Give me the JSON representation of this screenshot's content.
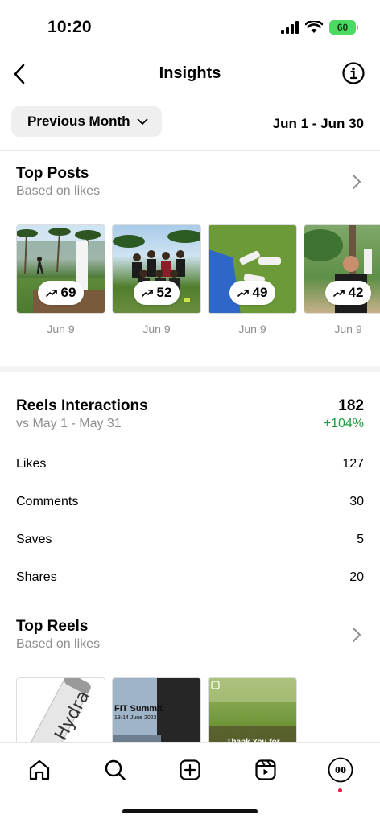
{
  "status_bar": {
    "time": "10:20",
    "battery": "60"
  },
  "header": {
    "title": "Insights"
  },
  "filter": {
    "period": "Previous Month",
    "date_range": "Jun 1 - Jun 30"
  },
  "top_posts": {
    "title": "Top Posts",
    "subtitle": "Based on likes",
    "posts": [
      {
        "likes": "69",
        "date": "Jun 9"
      },
      {
        "likes": "52",
        "date": "Jun 9"
      },
      {
        "likes": "49",
        "date": "Jun 9"
      },
      {
        "likes": "42",
        "date": "Jun 9"
      }
    ]
  },
  "reels_interactions": {
    "title": "Reels Interactions",
    "comparison": "vs May 1 - May 31",
    "total": "182",
    "change": "+104%",
    "change_color": "#1f9a3f",
    "metrics": [
      {
        "label": "Likes",
        "value": "127"
      },
      {
        "label": "Comments",
        "value": "30"
      },
      {
        "label": "Saves",
        "value": "5"
      },
      {
        "label": "Shares",
        "value": "20"
      }
    ]
  },
  "top_reels": {
    "title": "Top Reels",
    "subtitle": "Based on likes",
    "reels": [
      {
        "caption": "Hydra"
      },
      {
        "caption": "FIT Summit",
        "subcaption": "13-14 June 2023"
      },
      {
        "caption": "Thank You for"
      }
    ]
  },
  "bottom_nav": {
    "items": [
      "home-icon",
      "search-icon",
      "create-icon",
      "reels-icon",
      "profile-avatar"
    ]
  }
}
